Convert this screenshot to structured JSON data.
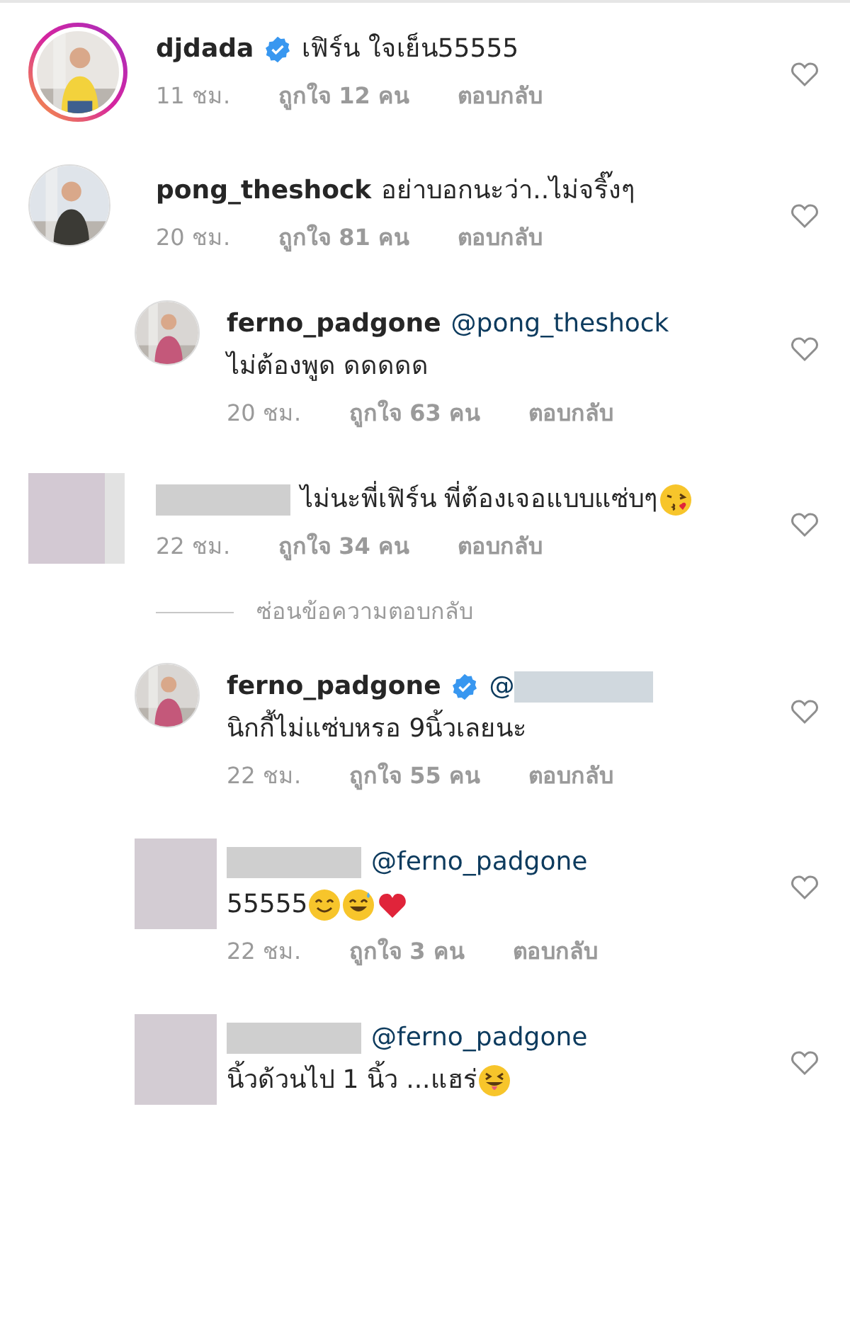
{
  "comments": [
    {
      "story_ring": true,
      "username": "djdada",
      "verified": true,
      "text": "เฟิร์น ใจเย็น55555",
      "time": "11 ชม.",
      "likes": "ถูกใจ 12 คน",
      "reply_label": "ตอบกลับ",
      "liked": false
    },
    {
      "story_ring": false,
      "username": "pong_theshock",
      "verified": false,
      "text": "อย่าบอกนะว่า..ไม่จริ๊งๆ",
      "time": "20 ชม.",
      "likes": "ถูกใจ 81 คน",
      "reply_label": "ตอบกลับ",
      "liked": false,
      "children": [
        {
          "story_ring": false,
          "username": "ferno_padgone",
          "verified": false,
          "mention": "@pong_theshock",
          "text": "ไม่ต้องพูด ดดดดด",
          "time": "20 ชม.",
          "likes": "ถูกใจ 63 คน",
          "reply_label": "ตอบกลับ",
          "liked": false
        }
      ]
    },
    {
      "kind": "blurred",
      "story_ring": false,
      "verified": false,
      "text": "ไม่นะพี่เฟิร์น พี่ต้องเจอแบบแซ่บๆ",
      "emojis": [
        {
          "kind": "kiss"
        }
      ],
      "time": "22 ชม.",
      "likes": "ถูกใจ 34 คน",
      "reply_label": "ตอบกลับ",
      "liked": false,
      "hide_replies": "ซ่อนข้อความตอบกลับ",
      "children": [
        {
          "story_ring": false,
          "username": "ferno_padgone",
          "verified": true,
          "mention": "@",
          "mention_blurred": true,
          "text": "นิกกี้ไม่แซ่บหรอ 9นิ้วเลยนะ",
          "time": "22 ชม.",
          "likes": "ถูกใจ 55 คน",
          "reply_label": "ตอบกลับ",
          "liked": false
        },
        {
          "kind": "blurred",
          "story_ring": false,
          "verified": false,
          "mention": "@ferno_padgone",
          "text": "55555",
          "emojis": [
            {
              "kind": "smile"
            },
            {
              "kind": "sweat-smile"
            },
            {
              "kind": "heart"
            }
          ],
          "time": "22 ชม.",
          "likes": "ถูกใจ 3 คน",
          "reply_label": "ตอบกลับ",
          "liked": false
        },
        {
          "kind": "blurred",
          "story_ring": false,
          "verified": false,
          "mention": "@ferno_padgone",
          "text": "นิ้วด้วนไป 1 นิ้ว ...แฮร่",
          "emojis": [
            {
              "kind": "tongue"
            }
          ],
          "liked": false
        }
      ]
    }
  ]
}
